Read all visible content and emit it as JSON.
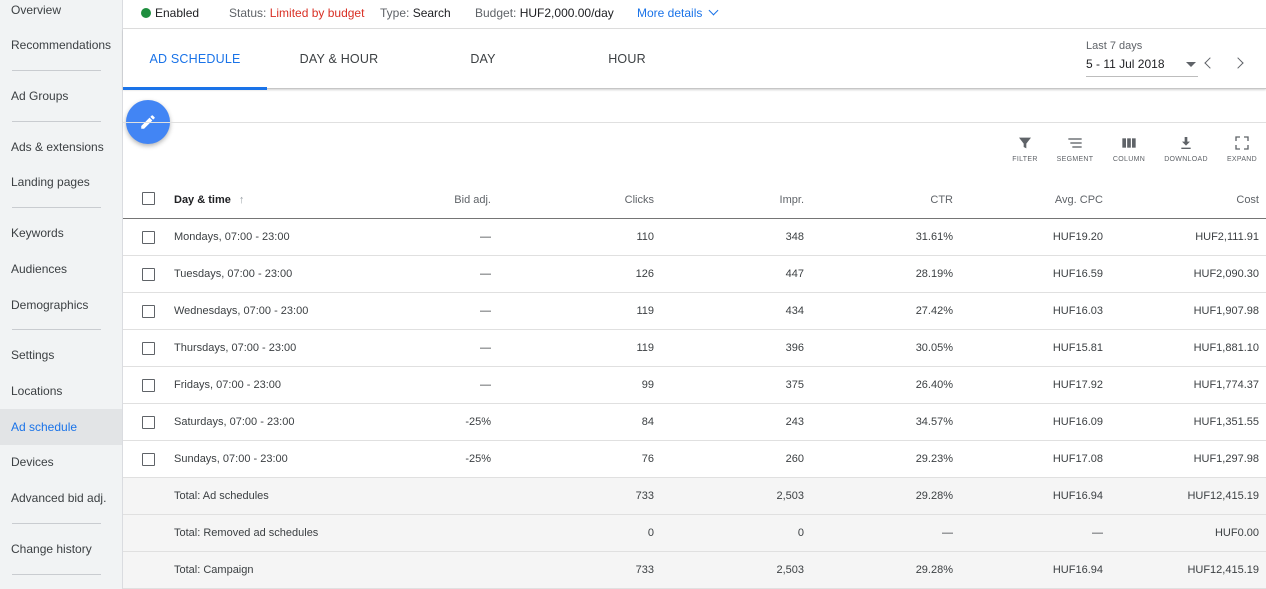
{
  "sidebar": {
    "items": [
      {
        "label": "Overview",
        "active": false
      },
      {
        "label": "Recommendations",
        "active": false
      },
      {
        "label": "Ad Groups",
        "active": false
      },
      {
        "label": "Ads & extensions",
        "active": false
      },
      {
        "label": "Landing pages",
        "active": false
      },
      {
        "label": "Keywords",
        "active": false
      },
      {
        "label": "Audiences",
        "active": false
      },
      {
        "label": "Demographics",
        "active": false
      },
      {
        "label": "Settings",
        "active": false
      },
      {
        "label": "Locations",
        "active": false
      },
      {
        "label": "Ad schedule",
        "active": true
      },
      {
        "label": "Devices",
        "active": false
      },
      {
        "label": "Advanced bid adj.",
        "active": false
      },
      {
        "label": "Change history",
        "active": false
      }
    ]
  },
  "status_bar": {
    "enabled_label": "Enabled",
    "status_label": "Status:",
    "status_value": "Limited by budget",
    "type_label": "Type:",
    "type_value": "Search",
    "budget_label": "Budget:",
    "budget_value": "HUF2,000.00/day",
    "more_details": "More details"
  },
  "tabs": [
    {
      "label": "AD SCHEDULE",
      "active": true
    },
    {
      "label": "DAY & HOUR",
      "active": false
    },
    {
      "label": "DAY",
      "active": false
    },
    {
      "label": "HOUR",
      "active": false
    }
  ],
  "date_range": {
    "caption": "Last 7 days",
    "value": "5 - 11 Jul 2018"
  },
  "toolbar": {
    "filter": "FILTER",
    "segment": "SEGMENT",
    "column": "COLUMN",
    "download": "DOWNLOAD",
    "expand": "EXPAND"
  },
  "table": {
    "headers": {
      "name": "Day & time",
      "bid": "Bid adj.",
      "clicks": "Clicks",
      "impr": "Impr.",
      "ctr": "CTR",
      "cpc": "Avg. CPC",
      "cost": "Cost"
    },
    "rows": [
      {
        "name": "Mondays, 07:00 - 23:00",
        "bid": "—",
        "clicks": "110",
        "impr": "348",
        "ctr": "31.61%",
        "cpc": "HUF19.20",
        "cost": "HUF2,111.91"
      },
      {
        "name": "Tuesdays, 07:00 - 23:00",
        "bid": "—",
        "clicks": "126",
        "impr": "447",
        "ctr": "28.19%",
        "cpc": "HUF16.59",
        "cost": "HUF2,090.30"
      },
      {
        "name": "Wednesdays, 07:00 - 23:00",
        "bid": "—",
        "clicks": "119",
        "impr": "434",
        "ctr": "27.42%",
        "cpc": "HUF16.03",
        "cost": "HUF1,907.98"
      },
      {
        "name": "Thursdays, 07:00 - 23:00",
        "bid": "—",
        "clicks": "119",
        "impr": "396",
        "ctr": "30.05%",
        "cpc": "HUF15.81",
        "cost": "HUF1,881.10"
      },
      {
        "name": "Fridays, 07:00 - 23:00",
        "bid": "—",
        "clicks": "99",
        "impr": "375",
        "ctr": "26.40%",
        "cpc": "HUF17.92",
        "cost": "HUF1,774.37"
      },
      {
        "name": "Saturdays, 07:00 - 23:00",
        "bid": "-25%",
        "clicks": "84",
        "impr": "243",
        "ctr": "34.57%",
        "cpc": "HUF16.09",
        "cost": "HUF1,351.55"
      },
      {
        "name": "Sundays, 07:00 - 23:00",
        "bid": "-25%",
        "clicks": "76",
        "impr": "260",
        "ctr": "29.23%",
        "cpc": "HUF17.08",
        "cost": "HUF1,297.98"
      }
    ],
    "totals": [
      {
        "name": "Total: Ad schedules",
        "bid": "",
        "clicks": "733",
        "impr": "2,503",
        "ctr": "29.28%",
        "cpc": "HUF16.94",
        "cost": "HUF12,415.19"
      },
      {
        "name": "Total: Removed ad schedules",
        "bid": "",
        "clicks": "0",
        "impr": "0",
        "ctr": "—",
        "cpc": "—",
        "cost": "HUF0.00"
      },
      {
        "name": "Total: Campaign",
        "bid": "",
        "clicks": "733",
        "impr": "2,503",
        "ctr": "29.28%",
        "cpc": "HUF16.94",
        "cost": "HUF12,415.19"
      }
    ]
  },
  "colors": {
    "accent": "#1a73e8",
    "enabled": "#1e8e3e",
    "warning": "#d93025",
    "fab": "#4285f4"
  }
}
